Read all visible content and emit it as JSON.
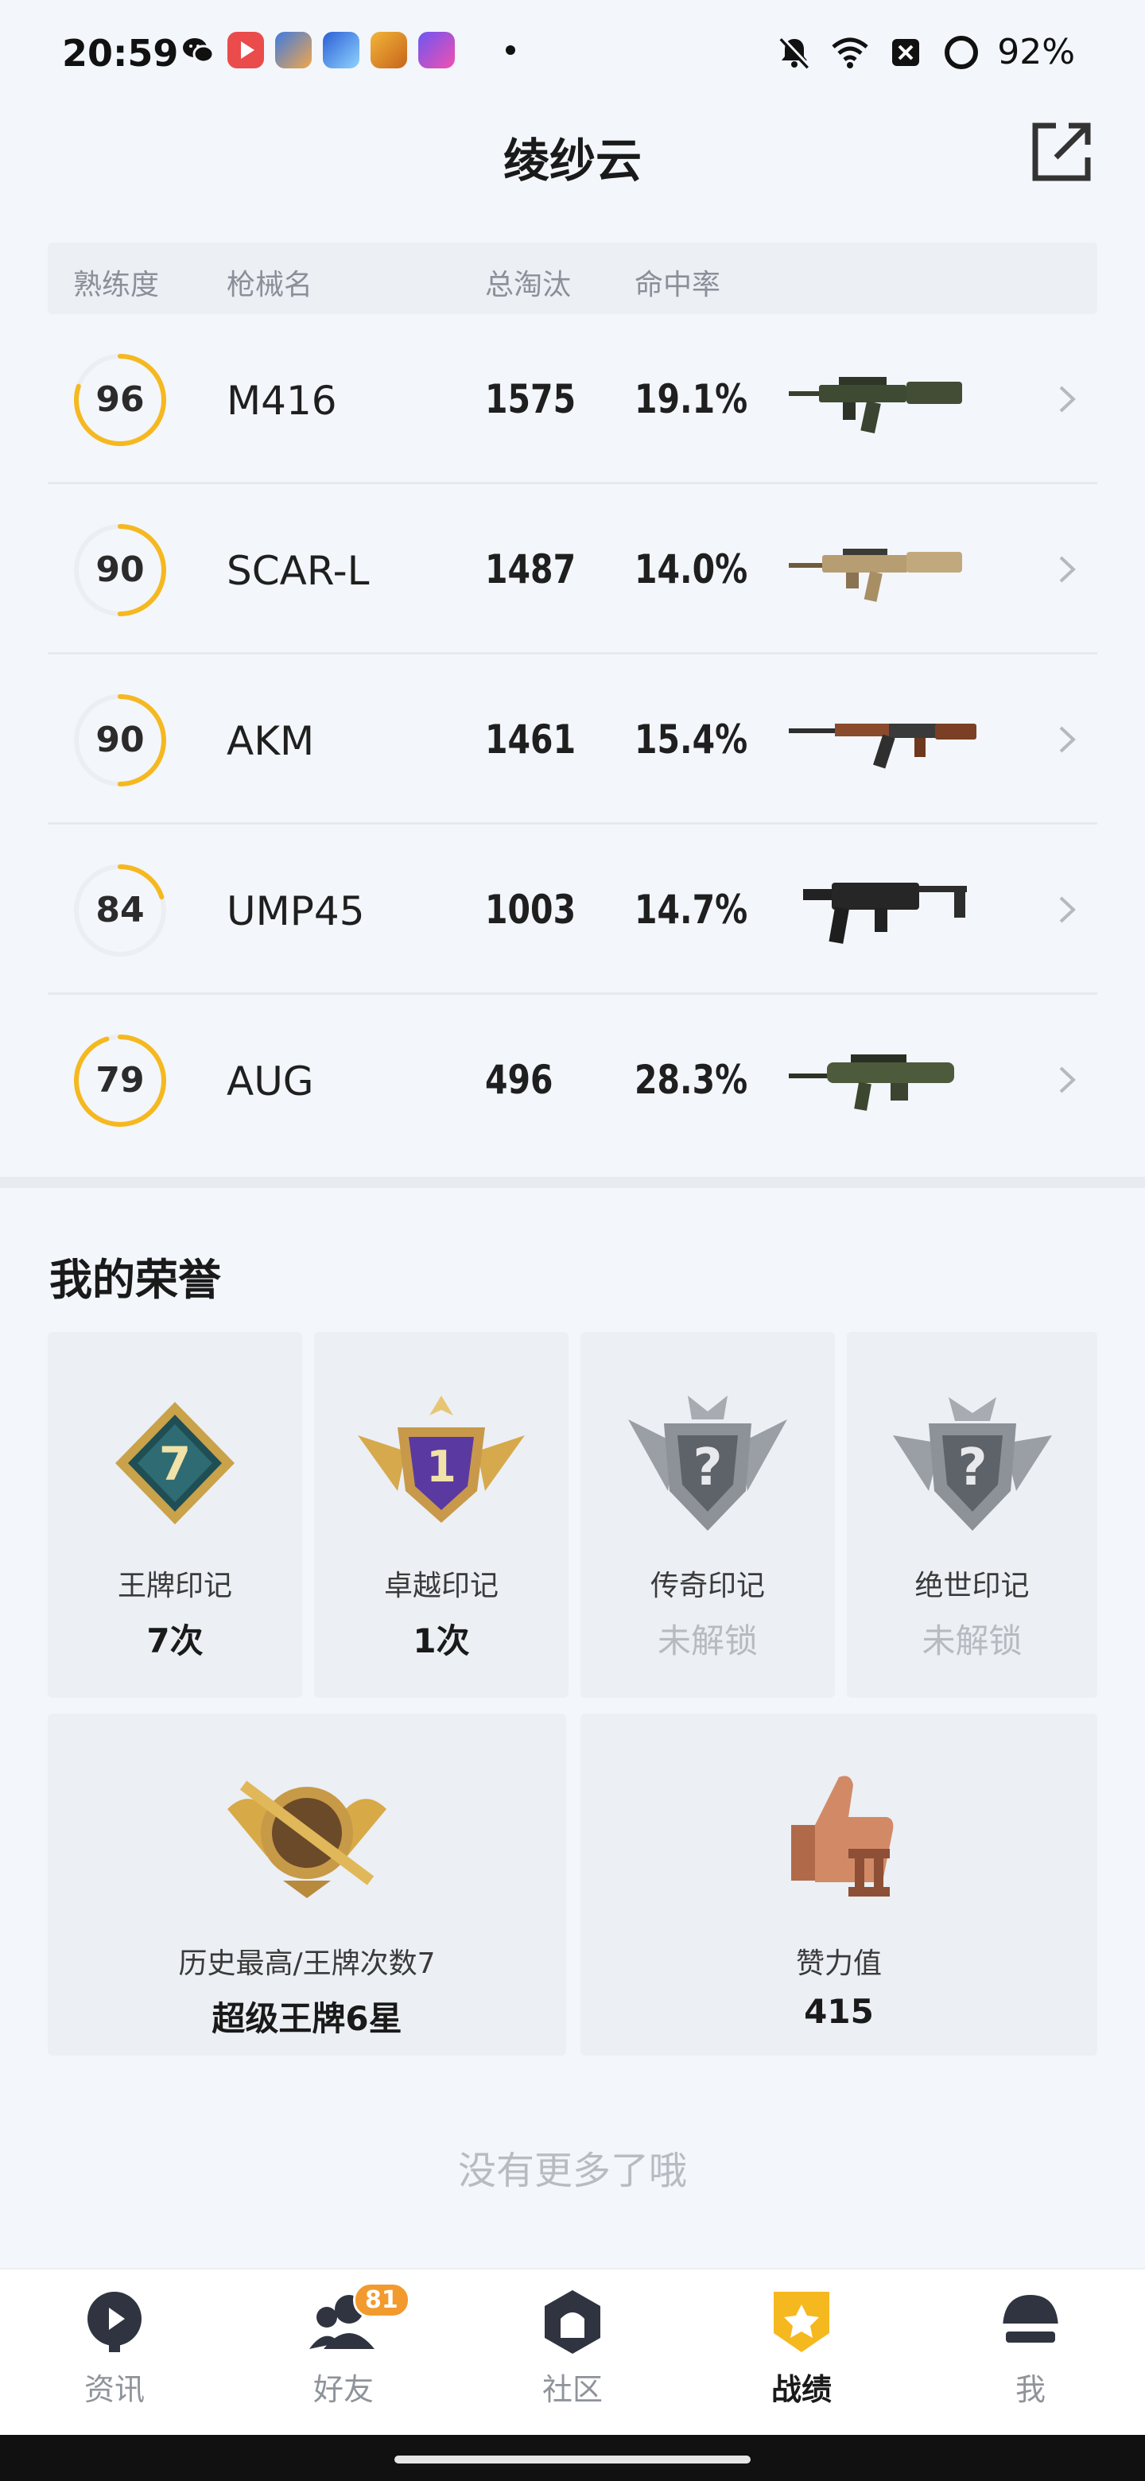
{
  "status_bar": {
    "time": "20:59",
    "battery": "92%"
  },
  "header": {
    "title": "绫纱云"
  },
  "table": {
    "columns": [
      "熟练度",
      "枪械名",
      "总淘汰",
      "命中率"
    ],
    "rows": [
      {
        "proficiency": 96,
        "name": "M416",
        "kills": "1575",
        "accuracy": "19.1%"
      },
      {
        "proficiency": 90,
        "name": "SCAR-L",
        "kills": "1487",
        "accuracy": "14.0%"
      },
      {
        "proficiency": 90,
        "name": "AKM",
        "kills": "1461",
        "accuracy": "15.4%"
      },
      {
        "proficiency": 84,
        "name": "UMP45",
        "kills": "1003",
        "accuracy": "14.7%"
      },
      {
        "proficiency": 79,
        "name": "AUG",
        "kills": "496",
        "accuracy": "28.3%"
      }
    ]
  },
  "honors": {
    "title": "我的荣誉",
    "cards": [
      {
        "label": "王牌印记",
        "value": "7次",
        "locked": false
      },
      {
        "label": "卓越印记",
        "value": "1次",
        "locked": false
      },
      {
        "label": "传奇印记",
        "value": "未解锁",
        "locked": true
      },
      {
        "label": "绝世印记",
        "value": "未解锁",
        "locked": true
      }
    ],
    "wide_cards": [
      {
        "label": "历史最高/王牌次数7",
        "value": "超级王牌6星"
      },
      {
        "label": "赞力值",
        "value": "415"
      }
    ]
  },
  "footer_text": "没有更多了哦",
  "nav": {
    "items": [
      {
        "label": "资讯",
        "active": false
      },
      {
        "label": "好友",
        "active": false,
        "badge": "81"
      },
      {
        "label": "社区",
        "active": false
      },
      {
        "label": "战绩",
        "active": true
      },
      {
        "label": "我",
        "active": false
      }
    ]
  },
  "colors": {
    "accent": "#f5b81f",
    "ring_track": "#eceef2"
  }
}
